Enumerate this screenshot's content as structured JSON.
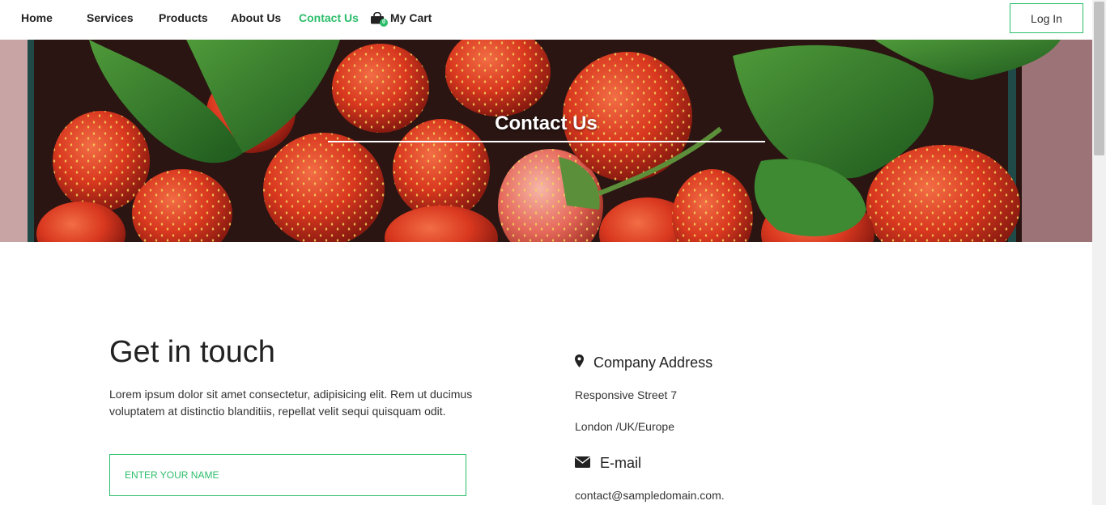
{
  "nav": {
    "links": [
      {
        "label": "Home"
      },
      {
        "label": "Services"
      },
      {
        "label": "Products"
      },
      {
        "label": "About Us"
      },
      {
        "label": "Contact Us",
        "active": true
      }
    ],
    "cart_label": "My Cart",
    "cart_icon": "shopping-bag-icon",
    "cart_count": "0",
    "login_label": "Log In"
  },
  "hero": {
    "title": "Contact Us",
    "image": "strawberries-in-basket"
  },
  "contact": {
    "heading": "Get in touch",
    "lead": "Lorem ipsum dolor sit amet consectetur, adipisicing elit. Rem ut ducimus voluptatem at distinctio blanditiis, repellat velit sequi quisquam odit.",
    "name_placeholder": "ENTER YOUR NAME",
    "address_title": "Company Address",
    "address_icon": "map-pin-icon",
    "address_line1": "Responsive Street 7",
    "address_line2": "London /UK/Europe",
    "email_title": "E-mail",
    "email_icon": "envelope-icon",
    "email_value": "contact@sampledomain.com."
  },
  "colors": {
    "accent": "#2bbd6a",
    "text": "#222222"
  }
}
